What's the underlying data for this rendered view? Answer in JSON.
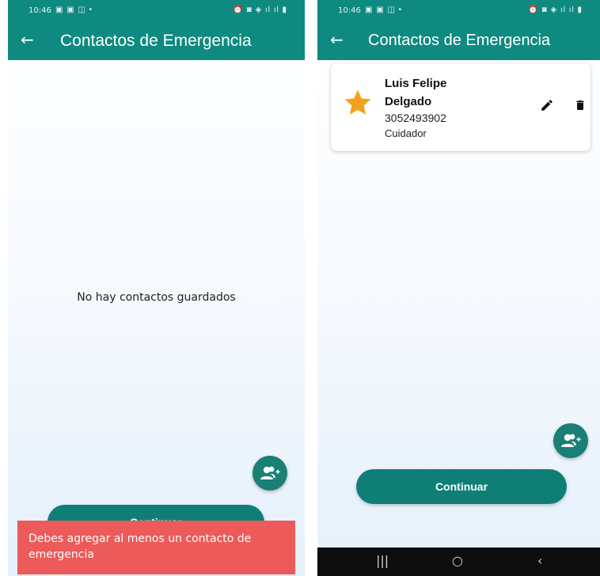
{
  "colors": {
    "app_bar": "#0f8a80",
    "primary_button": "#0f7f76",
    "fab": "#1a7f75",
    "snackbar": "#ec5a5a",
    "star": "#f3a21c"
  },
  "left_screen": {
    "status_bar": {
      "time": "10:46",
      "notif_icons": "▣ ▣ ◫ •",
      "sys_icons": "⏰ ◙ ◈ ıl ıl ▮"
    },
    "app_bar": {
      "back_icon": "←",
      "title": "Contactos de Emergencia"
    },
    "empty_message": "No hay contactos guardados",
    "fab_icon": "add-person-icon",
    "continue_button": "Continuar",
    "snackbar_message": "Debes agregar al menos un contacto de emergencia"
  },
  "right_screen": {
    "status_bar": {
      "time": "10:46",
      "notif_icons": "▣ ▣ ◫ •",
      "sys_icons": "⏰ ◙ ◈ ıl ıl ▮"
    },
    "app_bar": {
      "back_icon": "←",
      "title": "Contactos de Emergencia"
    },
    "contacts": [
      {
        "name": "Luis Felipe Delgado",
        "phone": "3052493902",
        "relation": "Cuidador",
        "favorite": true
      }
    ],
    "fab_icon": "add-person-icon",
    "continue_button": "Continuar",
    "nav_bar": {
      "recents": "|||",
      "home": "○",
      "back": "‹"
    }
  }
}
